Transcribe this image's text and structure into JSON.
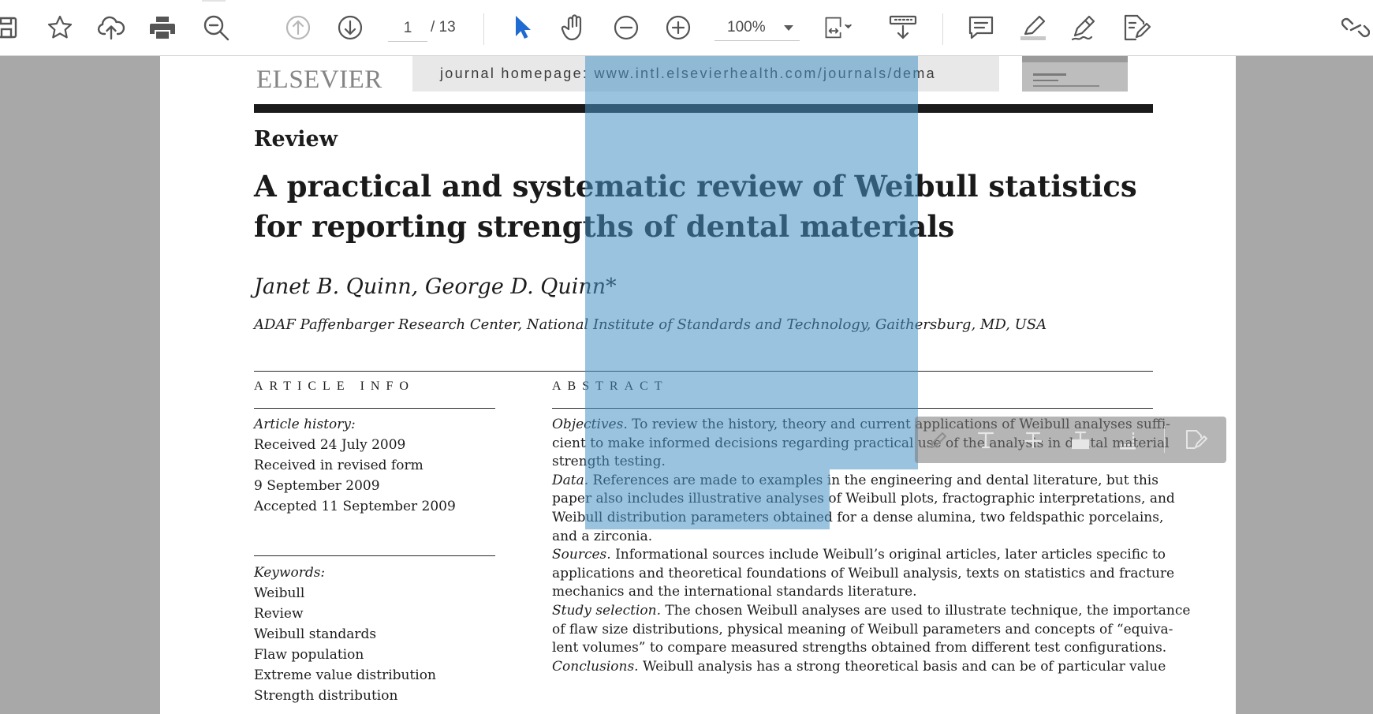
{
  "toolbar": {
    "icons": [
      "save-icon",
      "bookmark-star-icon",
      "cloud-upload-icon",
      "print-icon",
      "zoom-search-icon",
      "previous-page-icon",
      "next-page-icon",
      "select-arrow-icon",
      "hand-tool-icon",
      "zoom-out-icon",
      "zoom-in-icon",
      "fit-page-icon",
      "scroll-mode-icon",
      "comment-icon",
      "highlight-icon",
      "sign-icon",
      "edit-pdf-icon",
      "share-link-icon"
    ],
    "page_current": "1",
    "page_total": "/  13",
    "zoom_value": "100%"
  },
  "document": {
    "publisher": "ELSEVIER",
    "journal_homepage": "journal homepage: www.intl.elsevierhealth.com/journals/dema",
    "section": "Review",
    "title": "A practical and systematic review of Weibull statistics for reporting strengths of dental materials",
    "authors": "Janet B. Quinn, George D. Quinn*",
    "affiliation": "ADAF Paffenbarger Research Center, National Institute of Standards and Technology, Gaithersburg, MD, USA",
    "article_info": {
      "heading": "ARTICLE INFO",
      "history_label": "Article history:",
      "history": [
        "Received 24 July 2009",
        "Received in revised form",
        "9 September 2009",
        "Accepted 11 September 2009"
      ],
      "keywords_label": "Keywords:",
      "keywords": [
        "Weibull",
        "Review",
        "Weibull standards",
        "Flaw population",
        "Extreme value distribution",
        "Strength distribution"
      ]
    },
    "abstract": {
      "heading": "ABSTRACT",
      "lines": [
        {
          "lead": "Objectives.",
          "text": " To review the history, theory and current applications of Weibull analyses suffi-"
        },
        {
          "lead": "",
          "text": "cient to make informed decisions regarding practical use of the analysis in dental material"
        },
        {
          "lead": "",
          "text": "strength testing."
        },
        {
          "lead": "Data.",
          "text": " References are made to examples in the engineering and dental literature, but this"
        },
        {
          "lead": "",
          "text": "paper also includes illustrative analyses of Weibull plots, fractographic interpretations, and"
        },
        {
          "lead": "",
          "text": "Weibull distribution parameters obtained for a dense alumina, two feldspathic porcelains,"
        },
        {
          "lead": "",
          "text": "and a zirconia."
        },
        {
          "lead": "Sources.",
          "text": " Informational sources include Weibull’s original articles, later articles specific to"
        },
        {
          "lead": "",
          "text": "applications and theoretical foundations of Weibull analysis, texts on statistics and fracture"
        },
        {
          "lead": "",
          "text": "mechanics and the international standards literature."
        },
        {
          "lead": "Study selection.",
          "text": " The chosen Weibull analyses are used to illustrate technique, the importance"
        },
        {
          "lead": "",
          "text": "of flaw size distributions, physical meaning of Weibull parameters and concepts of “equiva-"
        },
        {
          "lead": "",
          "text": "lent volumes” to compare measured strengths obtained from different test configurations."
        },
        {
          "lead": "Conclusions.",
          "text": " Weibull analysis has a strong theoretical basis and can be of particular value"
        }
      ]
    }
  },
  "float_toolbar": {
    "icons": [
      "pencil-icon",
      "text-insert-icon",
      "strikethrough-icon",
      "replace-text-icon",
      "underline-icon",
      "edit-pdf-icon"
    ]
  },
  "colors": {
    "toolbar_bg": "#ffffff",
    "viewer_bg": "#a8a8a8",
    "selection": "#4792c7",
    "accent_blue": "#1f6bd1",
    "icon_gray": "#5a5a5a"
  }
}
